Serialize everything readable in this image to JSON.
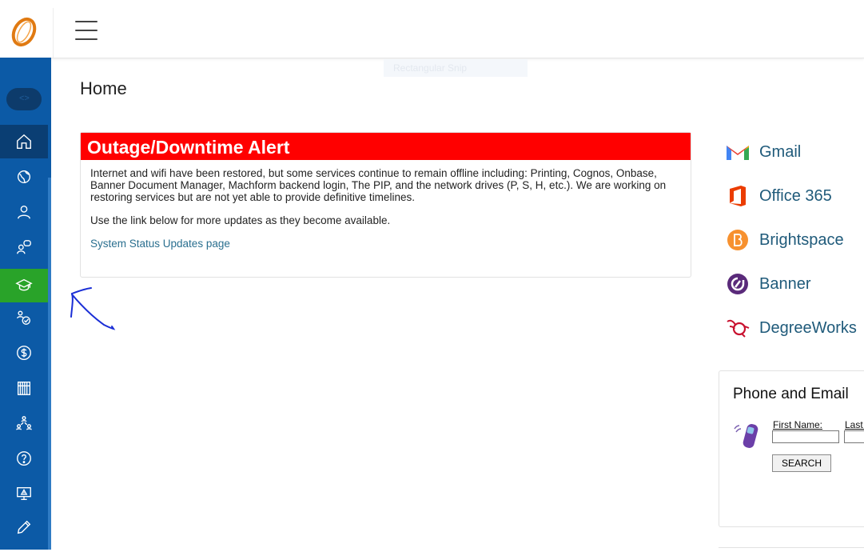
{
  "header": {
    "menu_icon": "hamburger-icon",
    "logo": "O"
  },
  "ghost_tooltip": "Rectangular Snip",
  "sidebar": {
    "items": [
      {
        "icon": "home-icon"
      },
      {
        "icon": "globe-icon"
      },
      {
        "icon": "person-icon"
      },
      {
        "icon": "advisor-chat-icon"
      },
      {
        "icon": "graduation-cap-icon"
      },
      {
        "icon": "registration-check-icon"
      },
      {
        "icon": "dollar-icon"
      },
      {
        "icon": "library-icon"
      },
      {
        "icon": "community-icon"
      },
      {
        "icon": "help-icon"
      },
      {
        "icon": "it-alert-icon"
      },
      {
        "icon": "pencil-icon"
      }
    ]
  },
  "page": {
    "title": "Home"
  },
  "alert": {
    "title": "Outage/Downtime Alert",
    "paragraph1": "Internet and wifi have been restored, but some services continue to remain offline including: Printing, Cognos, Onbase, Banner Document Manager, Machform backend login, The PIP, and the network drives (P, S, H, etc.). We are working on restoring services but are not yet able to provide definitive timelines.",
    "paragraph2": "Use the link below for more updates as they become available.",
    "link": "System Status Updates page"
  },
  "apps": [
    {
      "label": "Gmail",
      "icon": "gmail-icon"
    },
    {
      "label": "Office 365",
      "icon": "office-icon"
    },
    {
      "label": "Brightspace",
      "icon": "brightspace-icon"
    },
    {
      "label": "Banner",
      "icon": "banner-icon"
    },
    {
      "label": "DegreeWorks",
      "icon": "degreeworks-icon"
    }
  ],
  "phone_email": {
    "title": "Phone and Email",
    "first_name_label": "First Name:",
    "last_name_label": "Last Name:",
    "first_name_value": "",
    "last_name_value": "",
    "search_label": "SEARCH"
  },
  "colors": {
    "sidebar": "#0c5aa6",
    "alert_red": "#ff0000",
    "link": "#1f5a7a",
    "highlight": "#29a329"
  }
}
